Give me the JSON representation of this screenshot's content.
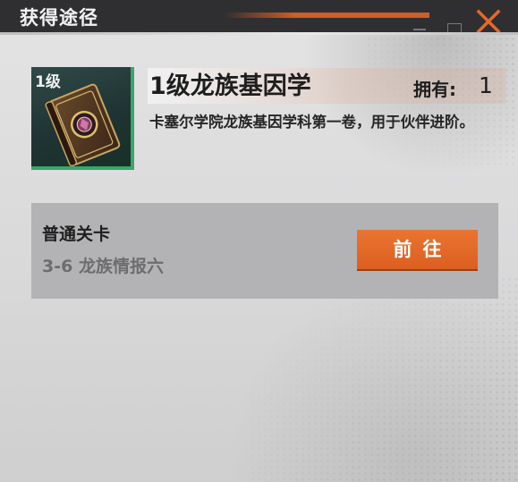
{
  "header": {
    "title": "获得途径"
  },
  "item": {
    "level_badge": "1级",
    "name": "1级龙族基因学",
    "owned_label": "拥有:",
    "owned_count": "1",
    "description": "卡塞尔学院龙族基因学科第一卷，用于伙伴进阶。",
    "icon": "book-icon"
  },
  "source": {
    "category": "普通关卡",
    "stage": "3-6 龙族情报六",
    "go_label": "前往"
  },
  "colors": {
    "accent_orange": "#e76729",
    "rarity_green": "#3aa66a",
    "header_bg": "#2f2f31"
  }
}
